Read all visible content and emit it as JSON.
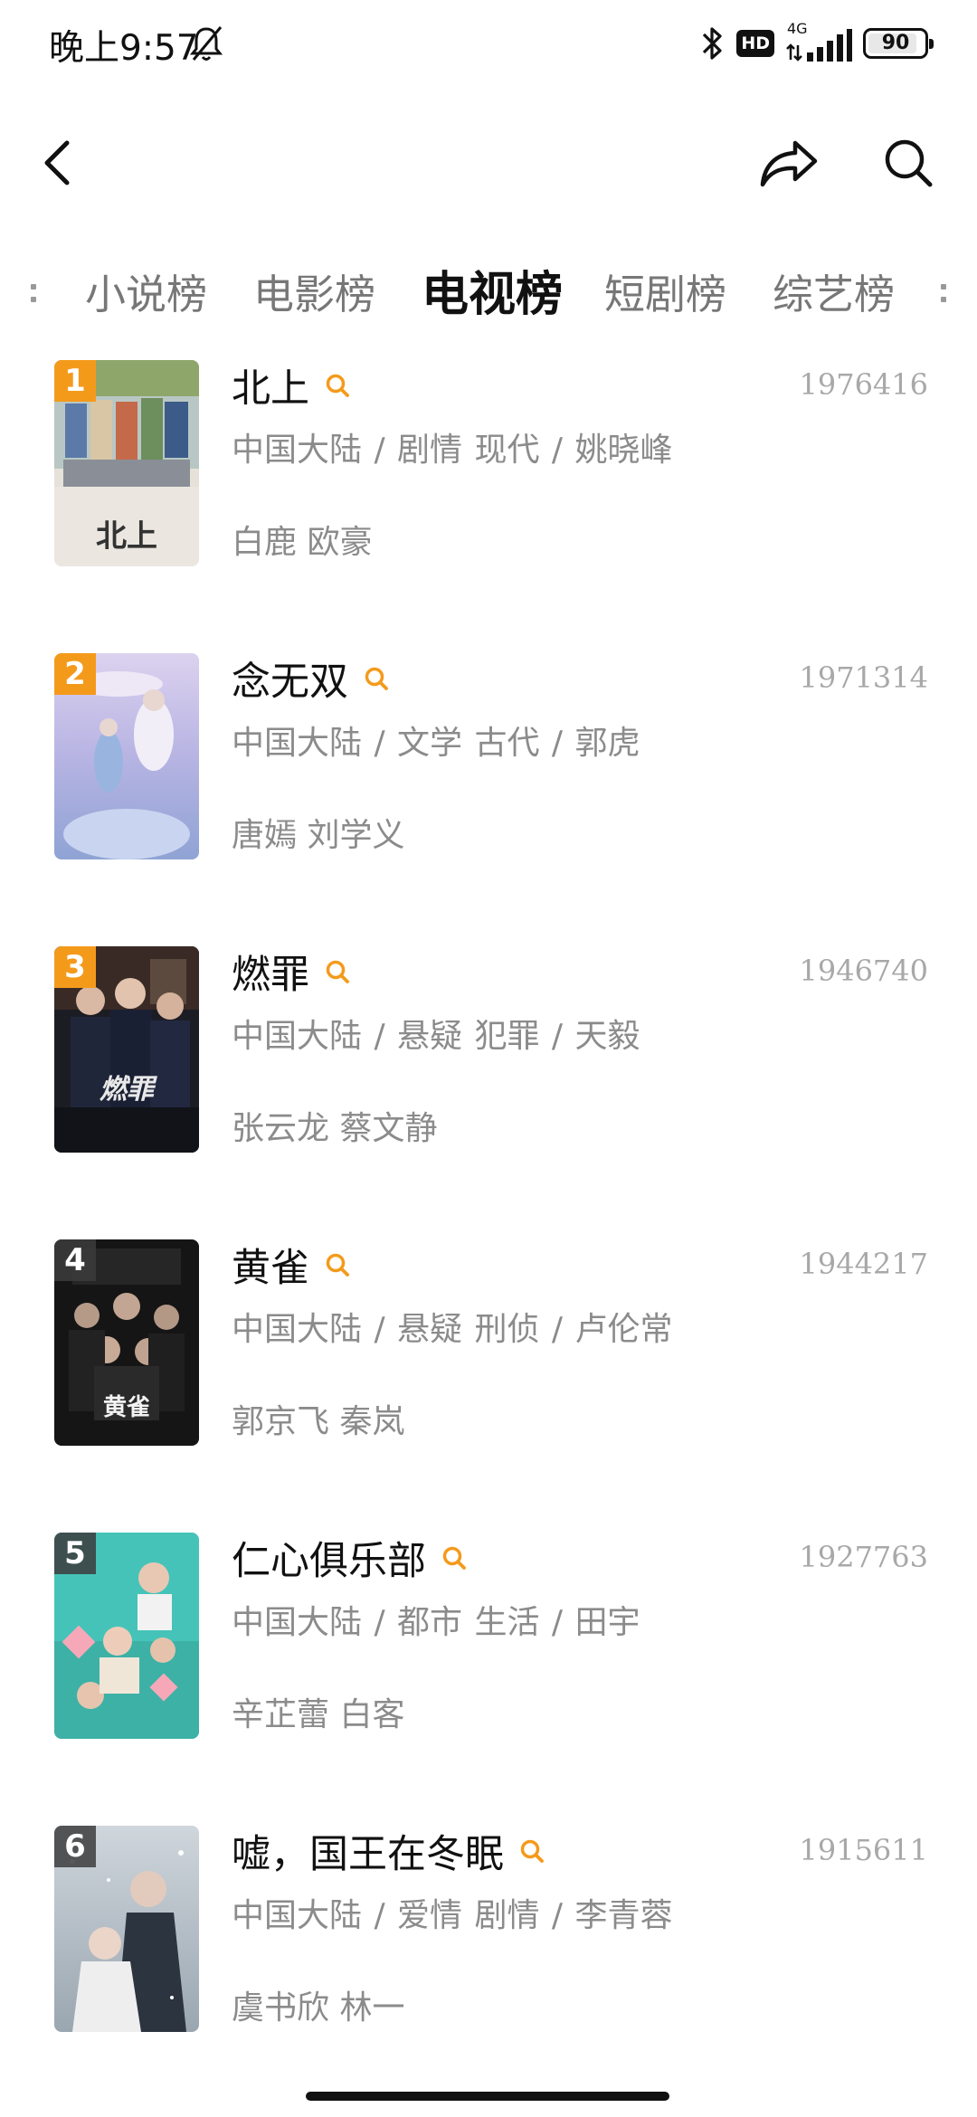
{
  "status_bar": {
    "time": "晚上9:57",
    "hd_badge": "HD",
    "network": "4G",
    "battery": "90",
    "battery_fraction": 0.9
  },
  "icons": {
    "back": "chevron-left-icon",
    "share": "share-arrow-icon",
    "search": "search-icon"
  },
  "tabs": [
    {
      "label": "小说榜",
      "active": false
    },
    {
      "label": "电影榜",
      "active": false
    },
    {
      "label": "电视榜",
      "active": true
    },
    {
      "label": "短剧榜",
      "active": false
    },
    {
      "label": "综艺榜",
      "active": false
    }
  ],
  "colors": {
    "accent": "#f49a1b",
    "title_text": "#111111",
    "secondary_text": "#8b8b8b",
    "heat_text": "#a8a8a8"
  },
  "list": [
    {
      "rank": "1",
      "title": "北上",
      "heat": "1976416",
      "meta": "中国大陆 / 剧情 现代 / 姚晓峰",
      "cast": "白鹿 欧豪"
    },
    {
      "rank": "2",
      "title": "念无双",
      "heat": "1971314",
      "meta": "中国大陆 / 文学 古代 / 郭虎",
      "cast": "唐嫣 刘学义"
    },
    {
      "rank": "3",
      "title": "燃罪",
      "heat": "1946740",
      "meta": "中国大陆 / 悬疑 犯罪 / 天毅",
      "cast": "张云龙 蔡文静"
    },
    {
      "rank": "4",
      "title": "黄雀",
      "heat": "1944217",
      "meta": "中国大陆 / 悬疑 刑侦 / 卢伦常",
      "cast": "郭京飞 秦岚"
    },
    {
      "rank": "5",
      "title": "仁心俱乐部",
      "heat": "1927763",
      "meta": "中国大陆 / 都市 生活 / 田宇",
      "cast": "辛芷蕾 白客"
    },
    {
      "rank": "6",
      "title": "嘘，国王在冬眠",
      "heat": "1915611",
      "meta": "中国大陆 / 爱情 剧情 / 李青蓉",
      "cast": "虞书欣 林一"
    }
  ]
}
